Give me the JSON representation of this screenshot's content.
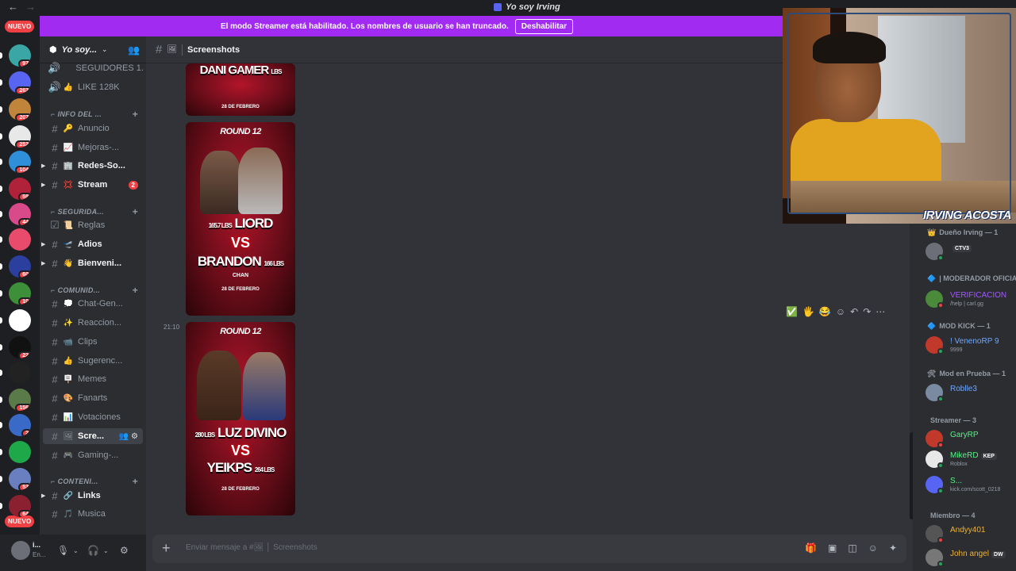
{
  "window": {
    "title": "Yo soy Irving",
    "back": "←",
    "forward": "→"
  },
  "banner": {
    "text": "El modo Streamer está habilitado. Los nombres de usuario se han truncado.",
    "button": "Deshabilitar"
  },
  "servers": {
    "new_top": "NUEVO",
    "new_bottom": "NUEVO",
    "items": [
      {
        "badge": "97",
        "color": "#3aa6a6"
      },
      {
        "badge": "263",
        "color": "#5865f2"
      },
      {
        "badge": "207",
        "color": "#c0843a"
      },
      {
        "badge": "252",
        "color": "#e8e8e8"
      },
      {
        "badge": "104",
        "color": "#2f8fd8"
      },
      {
        "badge": "58",
        "color": "#b0213a"
      },
      {
        "badge": "44",
        "color": "#d94a8a"
      },
      {
        "badge": "",
        "color": "#e84b6b"
      },
      {
        "badge": "60",
        "color": "#2b3f9e"
      },
      {
        "badge": "10",
        "color": "#3d8f3a"
      },
      {
        "badge": "",
        "color": "#ffffff"
      },
      {
        "badge": "22",
        "color": "#111111"
      },
      {
        "badge": "",
        "color": "#222222"
      },
      {
        "badge": "156",
        "color": "#5a7a4a"
      },
      {
        "badge": "2",
        "color": "#3a6ac8"
      },
      {
        "badge": "",
        "color": "#1fa84a"
      },
      {
        "badge": "53",
        "color": "#6a7fc0"
      },
      {
        "badge": "64",
        "color": "#8a2030"
      }
    ]
  },
  "guild": {
    "name": "Yo soy...",
    "invite_icon": "👥"
  },
  "channels": {
    "items": [
      {
        "type": "voice",
        "emoji": "",
        "label": "SEGUIDORES 1...",
        "bold": false
      },
      {
        "type": "voice",
        "emoji": "👍",
        "label": "LIKE 128K",
        "bold": false
      },
      {
        "type": "category",
        "label": "INFO DEL ..."
      },
      {
        "type": "text",
        "emoji": "🔑",
        "label": "Anuncio",
        "bold": false
      },
      {
        "type": "text",
        "emoji": "📈",
        "label": "Mejoras-...",
        "bold": false
      },
      {
        "type": "text",
        "emoji": "🏢",
        "label": "Redes-So...",
        "bold": true,
        "arrow": true
      },
      {
        "type": "text",
        "emoji": "💢",
        "label": "Stream",
        "bold": true,
        "arrow": true,
        "mention": "2"
      },
      {
        "type": "category",
        "label": "SEGURIDA..."
      },
      {
        "type": "rules",
        "emoji": "📜",
        "label": "Reglas",
        "bold": false
      },
      {
        "type": "text",
        "emoji": "🛫",
        "label": "Adios",
        "bold": true,
        "arrow": true
      },
      {
        "type": "text",
        "emoji": "👋",
        "label": "Bienveni...",
        "bold": true,
        "arrow": true
      },
      {
        "type": "category",
        "label": "COMUNID..."
      },
      {
        "type": "text",
        "emoji": "💭",
        "label": "Chat-Gen...",
        "bold": false
      },
      {
        "type": "text",
        "emoji": "✨",
        "label": "Reaccion...",
        "bold": false
      },
      {
        "type": "text",
        "emoji": "📹",
        "label": "Clips",
        "bold": false
      },
      {
        "type": "text",
        "emoji": "👍",
        "label": "Sugerenc...",
        "bold": false
      },
      {
        "type": "text",
        "emoji": "🪧",
        "label": "Memes",
        "bold": false
      },
      {
        "type": "text",
        "emoji": "🎨",
        "label": "Fanarts",
        "bold": false
      },
      {
        "type": "text",
        "emoji": "📊",
        "label": "Votaciones",
        "bold": false
      },
      {
        "type": "text",
        "emoji": "🖼",
        "label": "Scre...",
        "active": true
      },
      {
        "type": "text",
        "emoji": "🎮",
        "label": "Gaming-...",
        "bold": false
      },
      {
        "type": "category",
        "label": "CONTENI..."
      },
      {
        "type": "text",
        "emoji": "🔗",
        "label": "Links",
        "bold": true,
        "arrow": true
      },
      {
        "type": "text",
        "emoji": "🎵",
        "label": "Musica",
        "bold": false
      }
    ]
  },
  "user": {
    "name": "i...",
    "status": "En..."
  },
  "header": {
    "hash": "#",
    "emoji": "🖼",
    "title": "Screenshots"
  },
  "messages": {
    "timestamp": "21:10",
    "posters": [
      {
        "round": "",
        "name1": "DANI GAMER",
        "name1_lbs": "LBS",
        "vs": "",
        "name2": "",
        "date": "28 DE FEBRERO"
      },
      {
        "round": "ROUND 12",
        "name1": "LIORD",
        "name1_lbs": "165.7 LBS",
        "vs": "VS",
        "name2": "BRANDON",
        "name2_lbs": "166 LBS",
        "name2_sub": "CHAN",
        "date": "28 DE FEBRERO"
      },
      {
        "round": "ROUND 12",
        "name1": "LUZ DIVINO",
        "name1_lbs": "280 LBS",
        "vs": "VS",
        "name2": "YEIKPS",
        "name2_lbs": "264 LBS",
        "date": "28 DE FEBRERO"
      }
    ],
    "hover_tools": [
      "✅",
      "🖐",
      "😂",
      "☺",
      "↶",
      "↷",
      "⋯"
    ]
  },
  "composer": {
    "placeholder": "Enviar mensaje a #🖼 │ Screenshots",
    "plus": "+"
  },
  "members": {
    "groups": [
      {
        "label": "Dueño Irving — 1",
        "icon": "👑"
      },
      {
        "label": "| MODERADOR OFICIAL",
        "icon": "🔷"
      },
      {
        "label": "MOD KICK — 1",
        "icon": "🔷"
      },
      {
        "label": "Mod en Prueba — 1",
        "icon": "🛠"
      },
      {
        "label": "Streamer — 3",
        "icon": ""
      },
      {
        "label": "Miembro — 4",
        "icon": ""
      }
    ],
    "items": [
      {
        "name": "",
        "tag": "CTV3",
        "status": "",
        "color": "#dbdee1"
      },
      {
        "name": "VERIFICACION",
        "tag": "",
        "status": "/help | carl.gg",
        "color": "#a259ff"
      },
      {
        "name": "! VenenoRP 9",
        "tag": "",
        "status": "9999",
        "color": "#6fa8ff"
      },
      {
        "name": "Roblle3",
        "tag": "",
        "status": "",
        "color": "#6fa8ff"
      },
      {
        "name": "GaryRP",
        "tag": "",
        "status": "",
        "color": "#57f287"
      },
      {
        "name": "MikeRD",
        "tag": "KEP",
        "status": "Roblox",
        "color": "#57f287"
      },
      {
        "name": "S...",
        "tag": "",
        "status": "kick.com/scott_0218",
        "color": "#57f287"
      },
      {
        "name": "Andyy401",
        "tag": "",
        "status": "",
        "color": "#f0b232"
      },
      {
        "name": "John angel",
        "tag": "DW",
        "status": "",
        "color": "#f0b232"
      }
    ]
  },
  "webcam": {
    "name": "IRVING ACOSTA"
  }
}
